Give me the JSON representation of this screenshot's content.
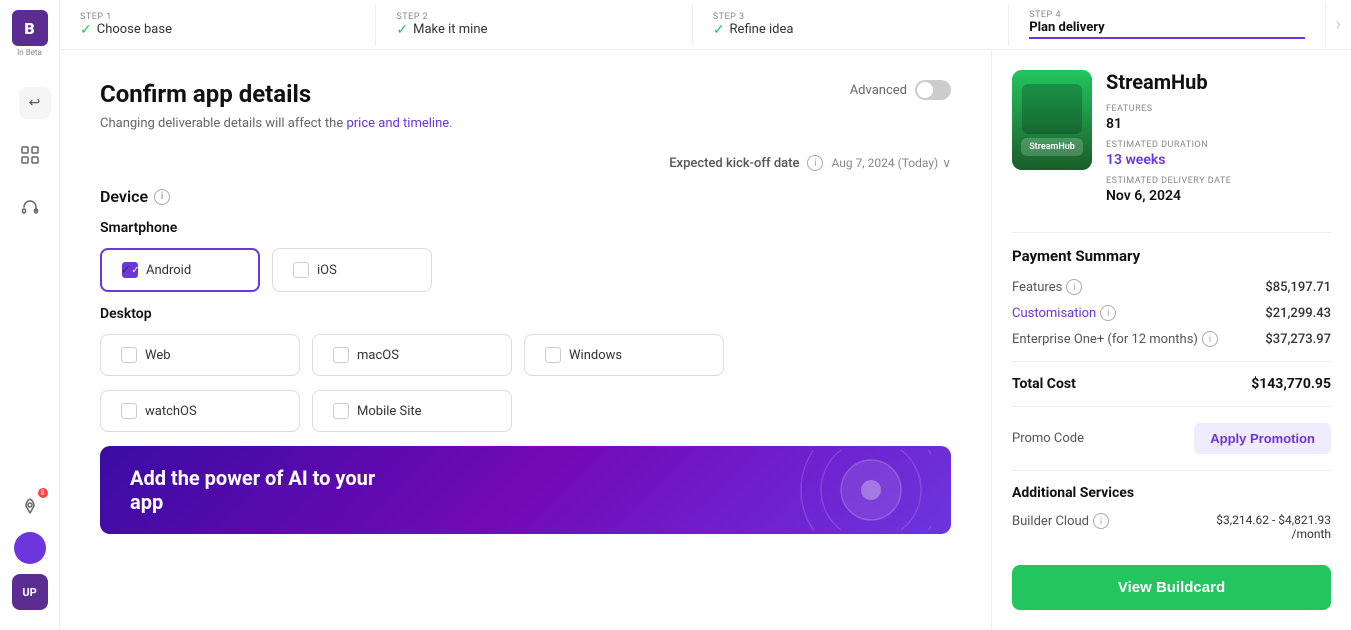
{
  "app": {
    "logo_letter": "B",
    "beta_label": "In Beta"
  },
  "stepper": {
    "steps": [
      {
        "number": "STEP 1",
        "label": "Choose base",
        "status": "done"
      },
      {
        "number": "STEP 2",
        "label": "Make it mine",
        "status": "done"
      },
      {
        "number": "STEP 3",
        "label": "Refine idea",
        "status": "done"
      },
      {
        "number": "STEP 4",
        "label": "Plan delivery",
        "status": "active"
      }
    ]
  },
  "page": {
    "title": "Confirm app details",
    "subtitle": "Changing deliverable details will affect the price and timeline.",
    "subtitle_highlight_words": "price and timeline",
    "advanced_label": "Advanced",
    "kickoff_label": "Expected kick-off date",
    "kickoff_value": "Aug 7, 2024 (Today)",
    "device_section": "Device",
    "smartphone_section": "Smartphone",
    "desktop_section": "Desktop",
    "ai_banner_text": "Add the power of AI to your app"
  },
  "devices": {
    "smartphone": [
      {
        "label": "Android",
        "selected": true
      },
      {
        "label": "iOS",
        "selected": false
      }
    ],
    "desktop": [
      {
        "label": "Web",
        "selected": false
      },
      {
        "label": "macOS",
        "selected": false
      },
      {
        "label": "Windows",
        "selected": false
      },
      {
        "label": "watchOS",
        "selected": false
      },
      {
        "label": "Mobile Site",
        "selected": false
      }
    ]
  },
  "right_panel": {
    "app_name": "StreamHub",
    "app_thumbnail_text": "StreamHub",
    "features_label": "FEATURES",
    "features_value": "81",
    "duration_label": "ESTIMATED DURATION",
    "duration_value": "13 weeks",
    "delivery_label": "ESTIMATED DELIVERY DATE",
    "delivery_value": "Nov 6, 2024",
    "payment_summary": {
      "title": "Payment Summary",
      "rows": [
        {
          "label": "Features",
          "value": "$85,197.71",
          "purple": false
        },
        {
          "label": "Customisation",
          "value": "$21,299.43",
          "purple": true
        },
        {
          "label": "Enterprise One+ (for 12 months)",
          "value": "$37,273.97",
          "purple": false
        }
      ],
      "total_label": "Total Cost",
      "total_value": "$143,770.95"
    },
    "promo": {
      "label": "Promo Code",
      "button_label": "Apply Promotion"
    },
    "additional_services": {
      "title": "Additional Services",
      "rows": [
        {
          "label": "Builder Cloud",
          "value": "$3,214.62 - $4,821.93\n/month"
        }
      ]
    },
    "view_buildcard_label": "View Buildcard"
  },
  "icons": {
    "undo": "↩",
    "grid": "⊞",
    "headset": "🎧",
    "rocket": "🚀",
    "chevron_right": "›",
    "chevron_down": "∨",
    "info": "i",
    "check": "✓"
  }
}
